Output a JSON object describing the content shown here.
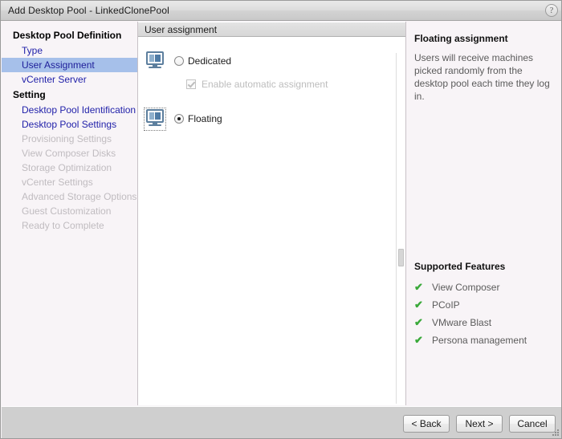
{
  "window": {
    "title": "Add Desktop Pool - LinkedClonePool",
    "help_icon": "question-mark-icon",
    "help_label": "?"
  },
  "sidebar": {
    "groups": [
      {
        "title": "Desktop Pool Definition",
        "items": [
          {
            "label": "Type",
            "state": "enabled"
          },
          {
            "label": "User Assignment",
            "state": "selected"
          },
          {
            "label": "vCenter Server",
            "state": "enabled"
          }
        ]
      },
      {
        "title": "Setting",
        "items": [
          {
            "label": "Desktop Pool Identification",
            "state": "enabled"
          },
          {
            "label": "Desktop Pool Settings",
            "state": "enabled"
          },
          {
            "label": "Provisioning Settings",
            "state": "disabled"
          },
          {
            "label": "View Composer Disks",
            "state": "disabled"
          },
          {
            "label": "Storage Optimization",
            "state": "disabled"
          },
          {
            "label": "vCenter Settings",
            "state": "disabled"
          },
          {
            "label": "Advanced Storage Options",
            "state": "disabled"
          },
          {
            "label": "Guest Customization",
            "state": "disabled"
          },
          {
            "label": "Ready to Complete",
            "state": "disabled"
          }
        ]
      }
    ]
  },
  "main": {
    "header": "User assignment",
    "options": [
      {
        "label": "Dedicated",
        "icon": "desktop-monitor-icon",
        "selected": false,
        "focused": false
      },
      {
        "label": "Floating",
        "icon": "desktop-monitor-icon",
        "selected": true,
        "focused": true
      }
    ],
    "sub_option": {
      "label": "Enable automatic assignment",
      "checked": true,
      "enabled": false
    }
  },
  "info_panel": {
    "title": "Floating assignment",
    "description": "Users will receive machines picked randomly from the desktop pool each time they log in.",
    "features_title": "Supported Features",
    "features": [
      "View Composer",
      "PCoIP",
      "VMware Blast",
      "Persona management"
    ],
    "check_glyph": "✔"
  },
  "footer": {
    "buttons": [
      {
        "label": "< Back",
        "name": "back-button"
      },
      {
        "label": "Next >",
        "name": "next-button"
      },
      {
        "label": "Cancel",
        "name": "cancel-button"
      }
    ]
  },
  "colors": {
    "selection": "#a6c0ea",
    "link": "#2222aa",
    "disabled": "#c0bcc0",
    "check_green": "#3aa93a",
    "panel_bg": "#f8f4f7"
  }
}
